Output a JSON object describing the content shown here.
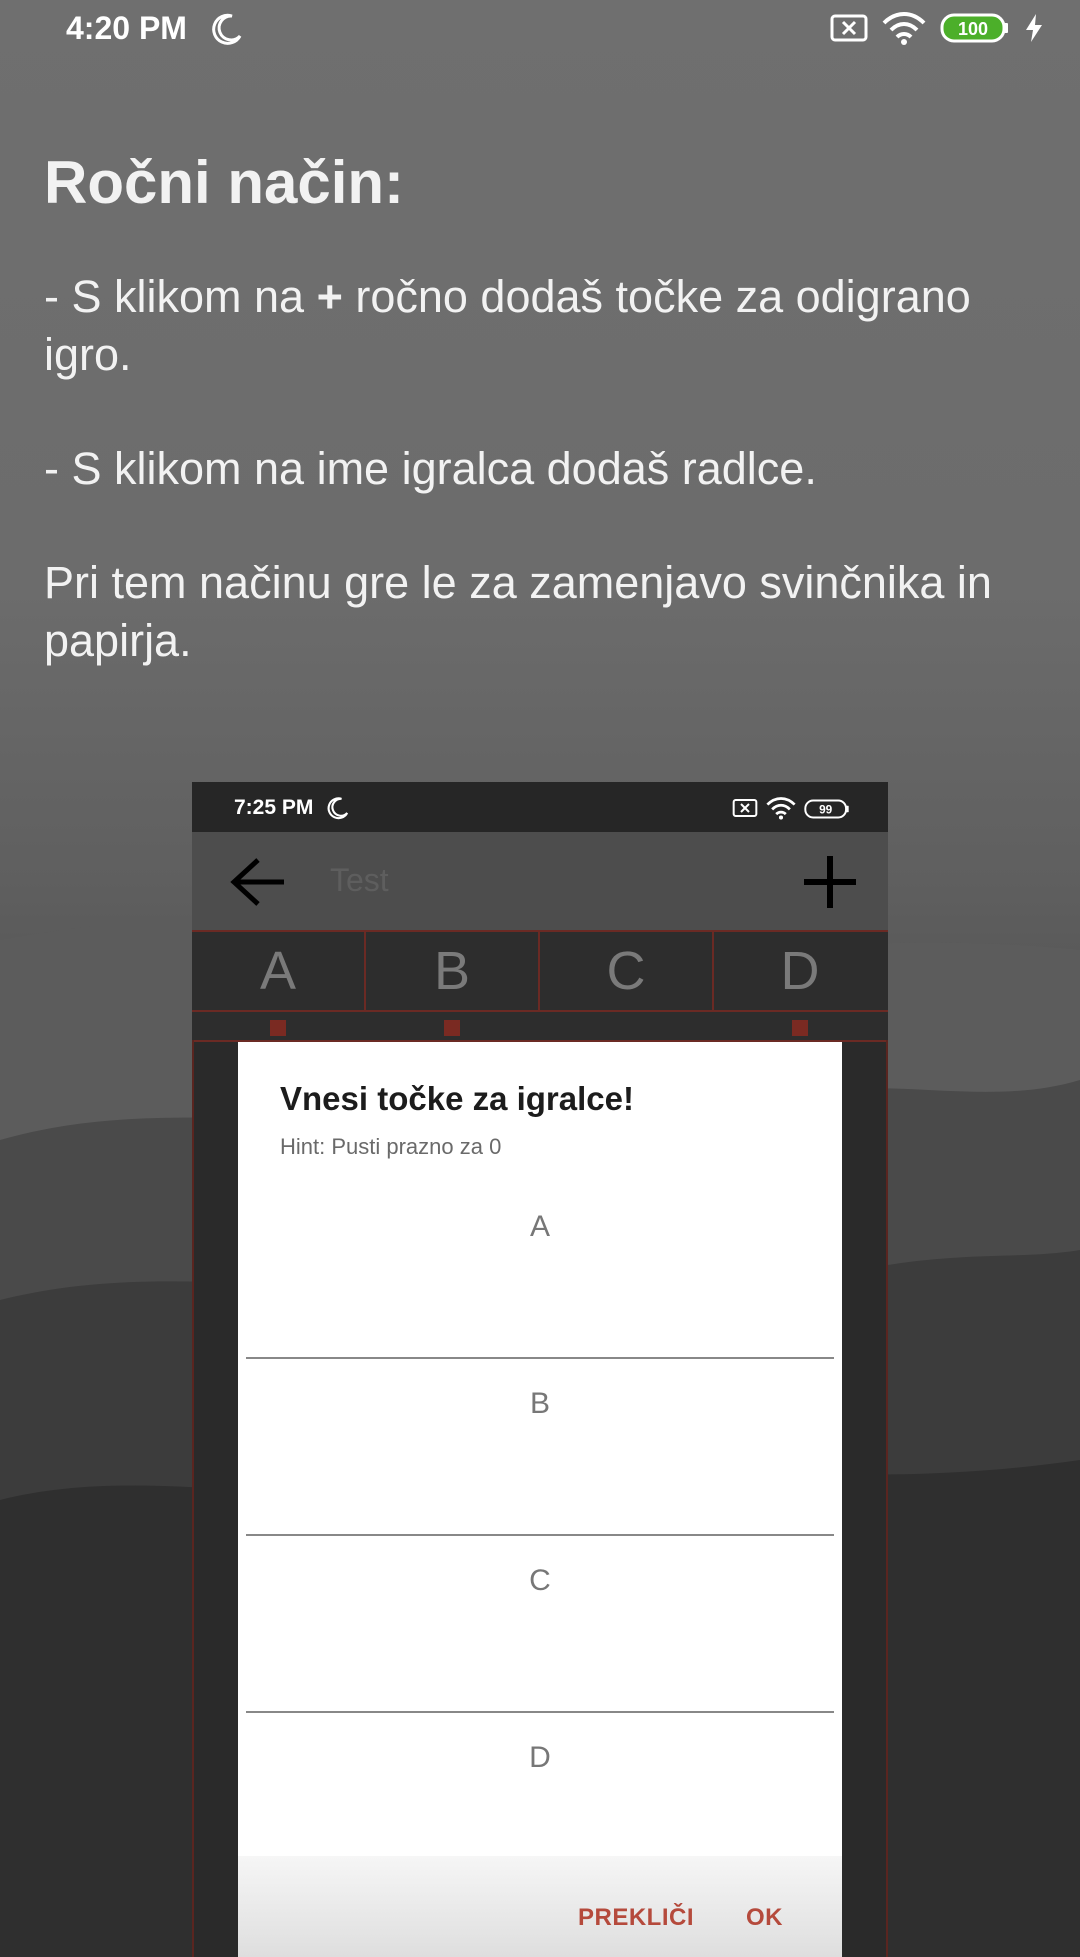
{
  "status_bar": {
    "time": "4:20 PM",
    "battery": "100"
  },
  "content": {
    "title": "Ročni način:",
    "para1_prefix": "- S klikom na ",
    "para1_bold": "+",
    "para1_suffix": " ročno dodaš točke za odigrano igro.",
    "para2": "- S klikom na ime igralca dodaš radlce.",
    "para3": "Pri tem načinu gre le za zamenjavo svinčnika in papirja."
  },
  "phone": {
    "status_time": "7:25 PM",
    "battery": "99",
    "toolbar_title": "Test",
    "columns": [
      "A",
      "B",
      "C",
      "D"
    ]
  },
  "dialog": {
    "title": "Vnesi točke za igralce!",
    "hint": "Hint: Pusti prazno za 0",
    "fields": [
      "A",
      "B",
      "C",
      "D"
    ],
    "cancel_label": "PREKLIČI",
    "ok_label": "OK"
  },
  "colors": {
    "accent": "#b54a3c",
    "grid_line": "#6b2a24",
    "battery_green": "#4caf2a"
  }
}
